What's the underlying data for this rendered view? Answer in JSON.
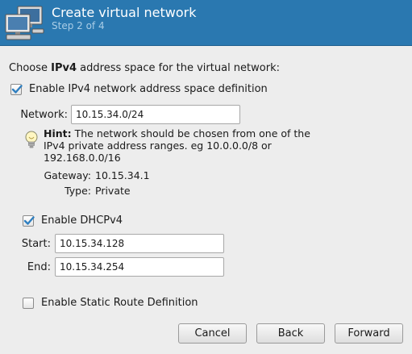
{
  "header": {
    "title": "Create virtual network",
    "subtitle": "Step 2 of 4",
    "icon": "network-computers-icon"
  },
  "prompt": {
    "prefix": "Choose ",
    "bold": "IPv4",
    "suffix": " address space for the virtual network:"
  },
  "ipv4": {
    "enable_label": "Enable IPv4 network address space definition",
    "enabled": true,
    "network_label": "Network:",
    "network_value": "10.15.34.0/24"
  },
  "hint": {
    "title": "Hint:",
    "text": " The network should be chosen from one of the IPv4 private address ranges. eg 10.0.0.0/8 or 192.168.0.0/16",
    "icon": "lightbulb-icon"
  },
  "info": {
    "gateway_label": "Gateway:",
    "gateway_value": "10.15.34.1",
    "type_label": "Type:",
    "type_value": "Private"
  },
  "dhcp": {
    "enable_label": "Enable DHCPv4",
    "enabled": true,
    "start_label": "Start:",
    "start_value": "10.15.34.128",
    "end_label": "End:",
    "end_value": "10.15.34.254"
  },
  "static_route": {
    "enable_label": "Enable Static Route Definition",
    "enabled": false
  },
  "buttons": {
    "cancel": "Cancel",
    "back": "Back",
    "forward": "Forward"
  },
  "colors": {
    "header_bg": "#2a78b0",
    "subtitle": "#a9cde6",
    "check": "#2f7fc0"
  }
}
